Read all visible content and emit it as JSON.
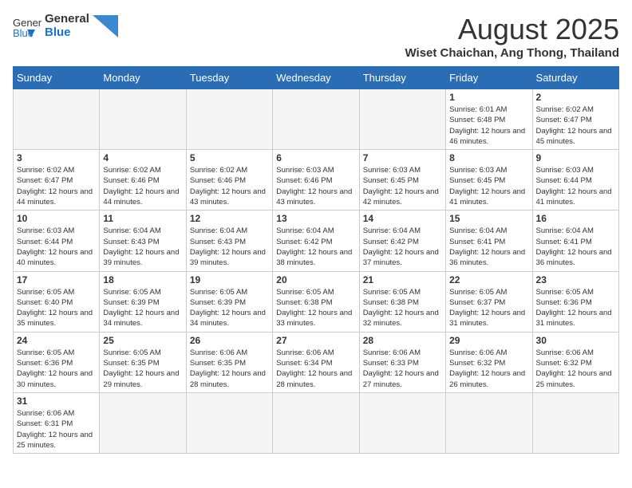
{
  "header": {
    "logo_general": "General",
    "logo_blue": "Blue",
    "title": "August 2025",
    "subtitle": "Wiset Chaichan, Ang Thong, Thailand"
  },
  "days_of_week": [
    "Sunday",
    "Monday",
    "Tuesday",
    "Wednesday",
    "Thursday",
    "Friday",
    "Saturday"
  ],
  "weeks": [
    [
      {
        "day": "",
        "info": ""
      },
      {
        "day": "",
        "info": ""
      },
      {
        "day": "",
        "info": ""
      },
      {
        "day": "",
        "info": ""
      },
      {
        "day": "",
        "info": ""
      },
      {
        "day": "1",
        "info": "Sunrise: 6:01 AM\nSunset: 6:48 PM\nDaylight: 12 hours and 46 minutes."
      },
      {
        "day": "2",
        "info": "Sunrise: 6:02 AM\nSunset: 6:47 PM\nDaylight: 12 hours and 45 minutes."
      }
    ],
    [
      {
        "day": "3",
        "info": "Sunrise: 6:02 AM\nSunset: 6:47 PM\nDaylight: 12 hours and 44 minutes."
      },
      {
        "day": "4",
        "info": "Sunrise: 6:02 AM\nSunset: 6:46 PM\nDaylight: 12 hours and 44 minutes."
      },
      {
        "day": "5",
        "info": "Sunrise: 6:02 AM\nSunset: 6:46 PM\nDaylight: 12 hours and 43 minutes."
      },
      {
        "day": "6",
        "info": "Sunrise: 6:03 AM\nSunset: 6:46 PM\nDaylight: 12 hours and 43 minutes."
      },
      {
        "day": "7",
        "info": "Sunrise: 6:03 AM\nSunset: 6:45 PM\nDaylight: 12 hours and 42 minutes."
      },
      {
        "day": "8",
        "info": "Sunrise: 6:03 AM\nSunset: 6:45 PM\nDaylight: 12 hours and 41 minutes."
      },
      {
        "day": "9",
        "info": "Sunrise: 6:03 AM\nSunset: 6:44 PM\nDaylight: 12 hours and 41 minutes."
      }
    ],
    [
      {
        "day": "10",
        "info": "Sunrise: 6:03 AM\nSunset: 6:44 PM\nDaylight: 12 hours and 40 minutes."
      },
      {
        "day": "11",
        "info": "Sunrise: 6:04 AM\nSunset: 6:43 PM\nDaylight: 12 hours and 39 minutes."
      },
      {
        "day": "12",
        "info": "Sunrise: 6:04 AM\nSunset: 6:43 PM\nDaylight: 12 hours and 39 minutes."
      },
      {
        "day": "13",
        "info": "Sunrise: 6:04 AM\nSunset: 6:42 PM\nDaylight: 12 hours and 38 minutes."
      },
      {
        "day": "14",
        "info": "Sunrise: 6:04 AM\nSunset: 6:42 PM\nDaylight: 12 hours and 37 minutes."
      },
      {
        "day": "15",
        "info": "Sunrise: 6:04 AM\nSunset: 6:41 PM\nDaylight: 12 hours and 36 minutes."
      },
      {
        "day": "16",
        "info": "Sunrise: 6:04 AM\nSunset: 6:41 PM\nDaylight: 12 hours and 36 minutes."
      }
    ],
    [
      {
        "day": "17",
        "info": "Sunrise: 6:05 AM\nSunset: 6:40 PM\nDaylight: 12 hours and 35 minutes."
      },
      {
        "day": "18",
        "info": "Sunrise: 6:05 AM\nSunset: 6:39 PM\nDaylight: 12 hours and 34 minutes."
      },
      {
        "day": "19",
        "info": "Sunrise: 6:05 AM\nSunset: 6:39 PM\nDaylight: 12 hours and 34 minutes."
      },
      {
        "day": "20",
        "info": "Sunrise: 6:05 AM\nSunset: 6:38 PM\nDaylight: 12 hours and 33 minutes."
      },
      {
        "day": "21",
        "info": "Sunrise: 6:05 AM\nSunset: 6:38 PM\nDaylight: 12 hours and 32 minutes."
      },
      {
        "day": "22",
        "info": "Sunrise: 6:05 AM\nSunset: 6:37 PM\nDaylight: 12 hours and 31 minutes."
      },
      {
        "day": "23",
        "info": "Sunrise: 6:05 AM\nSunset: 6:36 PM\nDaylight: 12 hours and 31 minutes."
      }
    ],
    [
      {
        "day": "24",
        "info": "Sunrise: 6:05 AM\nSunset: 6:36 PM\nDaylight: 12 hours and 30 minutes."
      },
      {
        "day": "25",
        "info": "Sunrise: 6:05 AM\nSunset: 6:35 PM\nDaylight: 12 hours and 29 minutes."
      },
      {
        "day": "26",
        "info": "Sunrise: 6:06 AM\nSunset: 6:35 PM\nDaylight: 12 hours and 28 minutes."
      },
      {
        "day": "27",
        "info": "Sunrise: 6:06 AM\nSunset: 6:34 PM\nDaylight: 12 hours and 28 minutes."
      },
      {
        "day": "28",
        "info": "Sunrise: 6:06 AM\nSunset: 6:33 PM\nDaylight: 12 hours and 27 minutes."
      },
      {
        "day": "29",
        "info": "Sunrise: 6:06 AM\nSunset: 6:32 PM\nDaylight: 12 hours and 26 minutes."
      },
      {
        "day": "30",
        "info": "Sunrise: 6:06 AM\nSunset: 6:32 PM\nDaylight: 12 hours and 25 minutes."
      }
    ],
    [
      {
        "day": "31",
        "info": "Sunrise: 6:06 AM\nSunset: 6:31 PM\nDaylight: 12 hours and 25 minutes."
      },
      {
        "day": "",
        "info": ""
      },
      {
        "day": "",
        "info": ""
      },
      {
        "day": "",
        "info": ""
      },
      {
        "day": "",
        "info": ""
      },
      {
        "day": "",
        "info": ""
      },
      {
        "day": "",
        "info": ""
      }
    ]
  ]
}
